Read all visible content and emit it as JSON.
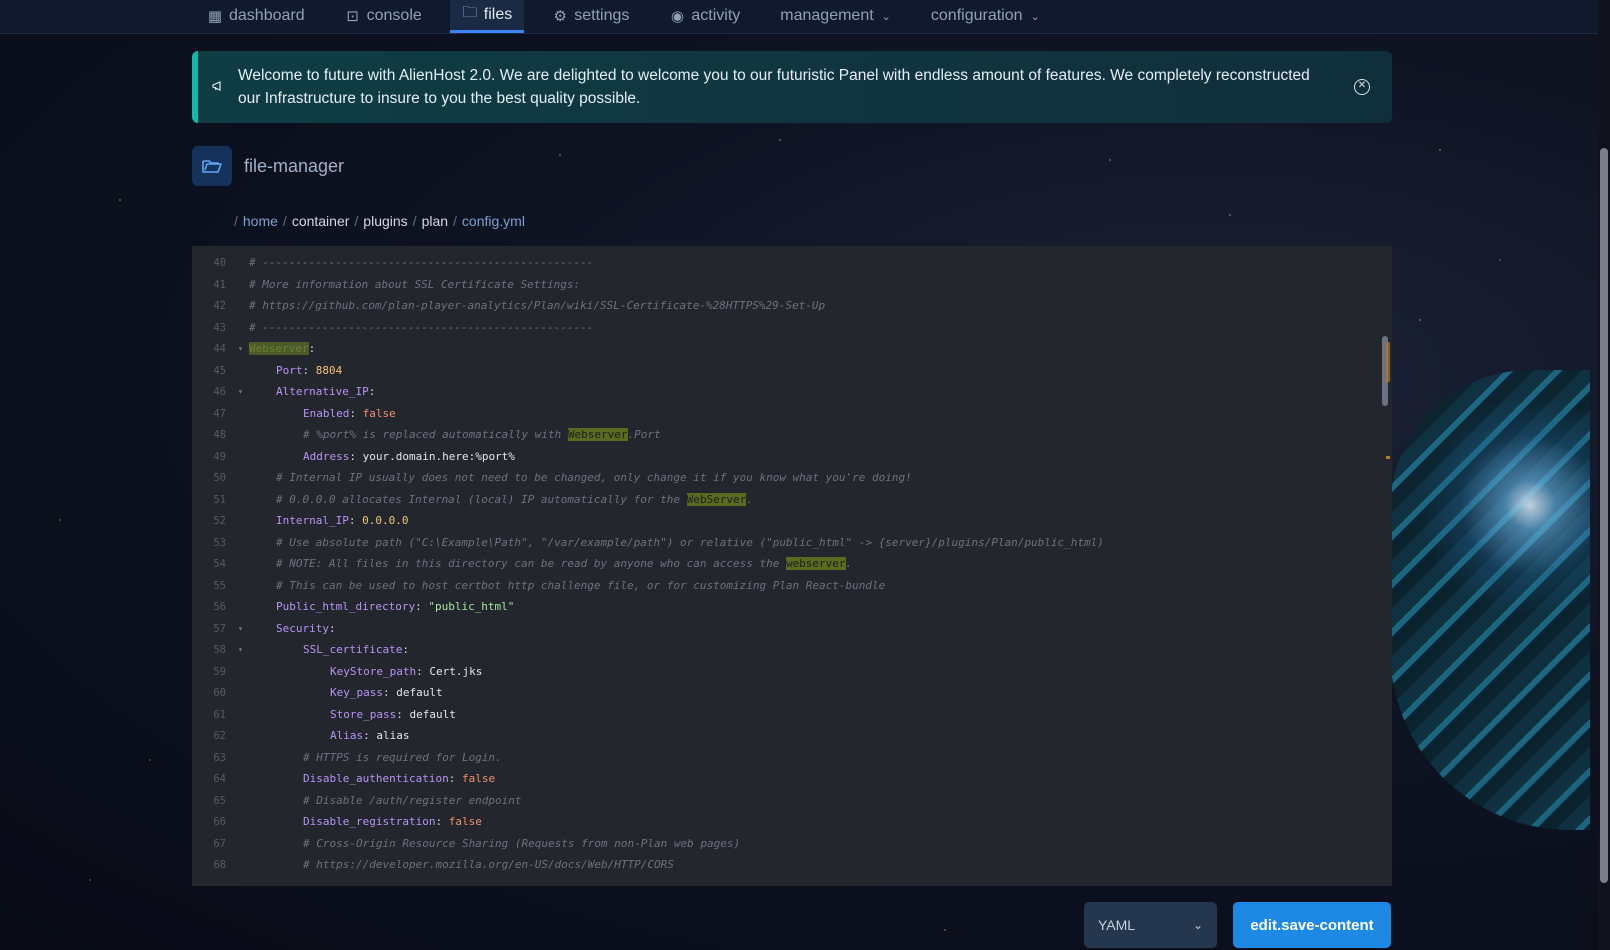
{
  "nav": {
    "items": [
      {
        "label": "dashboard",
        "icon": "grid-icon"
      },
      {
        "label": "console",
        "icon": "terminal-icon"
      },
      {
        "label": "files",
        "icon": "folder-icon"
      },
      {
        "label": "settings",
        "icon": "gear-icon"
      },
      {
        "label": "activity",
        "icon": "eye-icon"
      },
      {
        "label": "management",
        "icon": "chevron-down-icon"
      },
      {
        "label": "configuration",
        "icon": "chevron-down-icon"
      }
    ],
    "active": "files"
  },
  "banner": {
    "text": "Welcome to future with AlienHost 2.0. We are delighted to welcome you to our futuristic Panel with endless amount of features. We completely reconstructed our Infrastructure to insure to you the best quality possible."
  },
  "page": {
    "title": "file-manager"
  },
  "breadcrumb": [
    "home",
    "container",
    "plugins",
    "plan",
    "config.yml"
  ],
  "editor": {
    "lines": [
      {
        "n": "40",
        "fold": "",
        "indent": 0,
        "segs": [
          {
            "t": "# --------------------------------------------------",
            "c": "c-comment"
          }
        ]
      },
      {
        "n": "41",
        "fold": "",
        "indent": 0,
        "segs": [
          {
            "t": "# More information about SSL Certificate Settings:",
            "c": "c-comment"
          }
        ]
      },
      {
        "n": "42",
        "fold": "",
        "indent": 0,
        "segs": [
          {
            "t": "# https://github.com/plan-player-analytics/Plan/wiki/SSL-Certificate-%28HTTPS%29-Set-Up",
            "c": "c-comment"
          }
        ]
      },
      {
        "n": "43",
        "fold": "",
        "indent": 0,
        "segs": [
          {
            "t": "# --------------------------------------------------",
            "c": "c-comment"
          }
        ]
      },
      {
        "n": "44",
        "fold": "▾",
        "indent": 0,
        "segs": [
          {
            "t": "Webserver",
            "c": "hl-sel"
          },
          {
            "t": ":",
            "c": "c-punc"
          }
        ]
      },
      {
        "n": "45",
        "fold": "",
        "indent": 1,
        "segs": [
          {
            "t": "Port",
            "c": "c-key"
          },
          {
            "t": ": ",
            "c": "c-punc"
          },
          {
            "t": "8804",
            "c": "c-num"
          }
        ]
      },
      {
        "n": "46",
        "fold": "▾",
        "indent": 1,
        "segs": [
          {
            "t": "Alternative_IP",
            "c": "c-key"
          },
          {
            "t": ":",
            "c": "c-punc"
          }
        ]
      },
      {
        "n": "47",
        "fold": "",
        "indent": 2,
        "segs": [
          {
            "t": "Enabled",
            "c": "c-key"
          },
          {
            "t": ": ",
            "c": "c-punc"
          },
          {
            "t": "false",
            "c": "c-bool"
          }
        ]
      },
      {
        "n": "48",
        "fold": "",
        "indent": 2,
        "segs": [
          {
            "t": "# %port% is replaced automatically with ",
            "c": "c-comment"
          },
          {
            "t": "Webserver",
            "c": "hl"
          },
          {
            "t": ".Port",
            "c": "c-comment"
          }
        ]
      },
      {
        "n": "49",
        "fold": "",
        "indent": 2,
        "segs": [
          {
            "t": "Address",
            "c": "c-key"
          },
          {
            "t": ": ",
            "c": "c-punc"
          },
          {
            "t": "your.domain.here:%port%",
            "c": "c-plain"
          }
        ]
      },
      {
        "n": "50",
        "fold": "",
        "indent": 1,
        "segs": [
          {
            "t": "# Internal IP usually does not need to be changed, only change it if you know what you're doing!",
            "c": "c-comment"
          }
        ]
      },
      {
        "n": "51",
        "fold": "",
        "indent": 1,
        "segs": [
          {
            "t": "# 0.0.0.0 allocates Internal (local) IP automatically for the ",
            "c": "c-comment"
          },
          {
            "t": "WebServer",
            "c": "hl"
          },
          {
            "t": ".",
            "c": "c-comment"
          }
        ]
      },
      {
        "n": "52",
        "fold": "",
        "indent": 1,
        "segs": [
          {
            "t": "Internal_IP",
            "c": "c-key"
          },
          {
            "t": ": ",
            "c": "c-punc"
          },
          {
            "t": "0.0.0.0",
            "c": "c-num"
          }
        ]
      },
      {
        "n": "53",
        "fold": "",
        "indent": 1,
        "segs": [
          {
            "t": "# Use absolute path (\"C:\\Example\\Path\", \"/var/example/path\") or relative (\"public_html\" -> {server}/plugins/Plan/public_html)",
            "c": "c-comment"
          }
        ]
      },
      {
        "n": "54",
        "fold": "",
        "indent": 1,
        "segs": [
          {
            "t": "# NOTE: All files in this directory can be read by anyone who can access the ",
            "c": "c-comment"
          },
          {
            "t": "webserver",
            "c": "hl"
          },
          {
            "t": ".",
            "c": "c-comment"
          }
        ]
      },
      {
        "n": "55",
        "fold": "",
        "indent": 1,
        "segs": [
          {
            "t": "# This can be used to host certbot http challenge file, or for customizing Plan React-bundle",
            "c": "c-comment"
          }
        ]
      },
      {
        "n": "56",
        "fold": "",
        "indent": 1,
        "segs": [
          {
            "t": "Public_html_directory",
            "c": "c-key"
          },
          {
            "t": ": ",
            "c": "c-punc"
          },
          {
            "t": "\"public_html\"",
            "c": "c-str"
          }
        ]
      },
      {
        "n": "57",
        "fold": "▾",
        "indent": 1,
        "segs": [
          {
            "t": "Security",
            "c": "c-key"
          },
          {
            "t": ":",
            "c": "c-punc"
          }
        ]
      },
      {
        "n": "58",
        "fold": "▾",
        "indent": 2,
        "segs": [
          {
            "t": "SSL_certificate",
            "c": "c-key"
          },
          {
            "t": ":",
            "c": "c-punc"
          }
        ]
      },
      {
        "n": "59",
        "fold": "",
        "indent": 3,
        "segs": [
          {
            "t": "KeyStore_path",
            "c": "c-key"
          },
          {
            "t": ": ",
            "c": "c-punc"
          },
          {
            "t": "Cert.jks",
            "c": "c-plain"
          }
        ]
      },
      {
        "n": "60",
        "fold": "",
        "indent": 3,
        "segs": [
          {
            "t": "Key_pass",
            "c": "c-key"
          },
          {
            "t": ": ",
            "c": "c-punc"
          },
          {
            "t": "default",
            "c": "c-plain"
          }
        ]
      },
      {
        "n": "61",
        "fold": "",
        "indent": 3,
        "segs": [
          {
            "t": "Store_pass",
            "c": "c-key"
          },
          {
            "t": ": ",
            "c": "c-punc"
          },
          {
            "t": "default",
            "c": "c-plain"
          }
        ]
      },
      {
        "n": "62",
        "fold": "",
        "indent": 3,
        "segs": [
          {
            "t": "Alias",
            "c": "c-key"
          },
          {
            "t": ": ",
            "c": "c-punc"
          },
          {
            "t": "alias",
            "c": "c-plain"
          }
        ]
      },
      {
        "n": "63",
        "fold": "",
        "indent": 2,
        "segs": [
          {
            "t": "# HTTPS is required for Login.",
            "c": "c-comment"
          }
        ]
      },
      {
        "n": "64",
        "fold": "",
        "indent": 2,
        "segs": [
          {
            "t": "Disable_authentication",
            "c": "c-key"
          },
          {
            "t": ": ",
            "c": "c-punc"
          },
          {
            "t": "false",
            "c": "c-bool"
          }
        ]
      },
      {
        "n": "65",
        "fold": "",
        "indent": 2,
        "segs": [
          {
            "t": "# Disable /auth/register endpoint",
            "c": "c-comment"
          }
        ]
      },
      {
        "n": "66",
        "fold": "",
        "indent": 2,
        "segs": [
          {
            "t": "Disable_registration",
            "c": "c-key"
          },
          {
            "t": ": ",
            "c": "c-punc"
          },
          {
            "t": "false",
            "c": "c-bool"
          }
        ]
      },
      {
        "n": "67",
        "fold": "",
        "indent": 2,
        "segs": [
          {
            "t": "# Cross-Origin Resource Sharing (Requests from non-Plan web pages)",
            "c": "c-comment"
          }
        ]
      },
      {
        "n": "68",
        "fold": "",
        "indent": 2,
        "segs": [
          {
            "t": "# https://developer.mozilla.org/en-US/docs/Web/HTTP/CORS",
            "c": "c-comment"
          }
        ]
      }
    ]
  },
  "footer": {
    "language": "YAML",
    "save_label": "edit.save-content"
  },
  "colors": {
    "accent": "#1e88e5",
    "banner_border": "#14b8a6",
    "editor_bg": "#23262d"
  }
}
